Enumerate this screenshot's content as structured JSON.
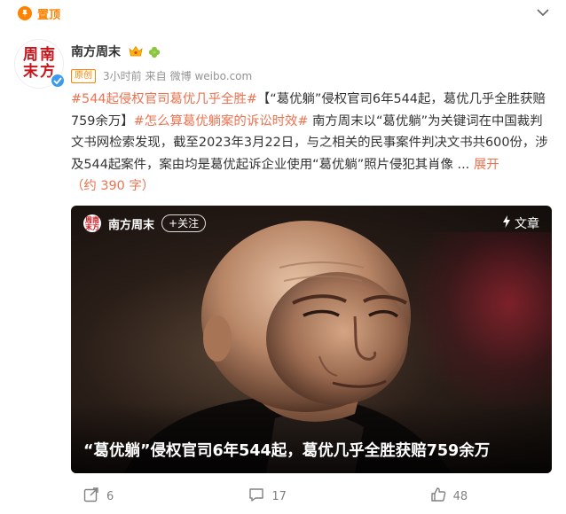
{
  "pin": {
    "label": "置顶"
  },
  "user": {
    "name": "南方周末",
    "avatar_chars": [
      "周",
      "南",
      "末",
      "方"
    ],
    "time": "3小时前",
    "source_prefix": "来自",
    "source": "微博 weibo.com",
    "original_badge": "原创"
  },
  "post": {
    "topic1": "#544起侵权官司葛优几乎全胜#",
    "text1": "【“葛优躺”侵权官司6年544起，葛优几乎全胜获赔759余万】",
    "topic2": "#怎么算葛优躺案的诉讼时效#",
    "text2": " 南方周末以“葛优躺”为关键词在中国裁判文书网检索发现，截至2023年3月22日，与之相关的民事案件判决文书共600份，涉及544起案件，案由均是葛优起诉企业使用“葛优躺”照片侵犯其肖像 ...",
    "expand": "展开",
    "word_count": "（约 390 字）"
  },
  "media": {
    "source_name": "南方周末",
    "follow_label": "+关注",
    "type_label": "文章",
    "title": "“葛优躺”侵权官司6年544起，葛优几乎全胜获赔759余万"
  },
  "actions": {
    "share_count": "6",
    "comment_count": "17",
    "like_count": "48"
  },
  "colors": {
    "accent": "#ff8200",
    "topic": "#eb7350",
    "verify": "#3d9be9",
    "brand_red": "#c8161d"
  }
}
